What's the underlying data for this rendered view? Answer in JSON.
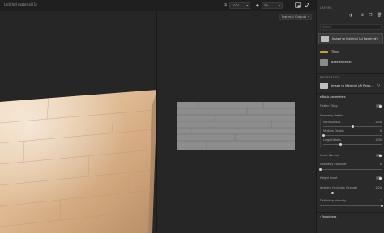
{
  "window": {
    "title": "Untitled material (1)"
  },
  "toolbar": {
    "resolution": "1024",
    "channels": "3D",
    "screenshot_icon": "camera-icon",
    "expand_icon": "expand-icon"
  },
  "viewport": {
    "mode_label": "Material Outputs"
  },
  "layers": {
    "heading": "LAYERS",
    "search_placeholder": "Search",
    "items": [
      {
        "label": "Image to Material (AI Powered)",
        "selected": true,
        "thumb_color": "#bdbdbd"
      },
      {
        "label": "Tiling",
        "selected": false,
        "thumb_color": "#c9a227"
      },
      {
        "label": "Base Material",
        "selected": false,
        "thumb_color": "#8a8a8a"
      }
    ]
  },
  "properties": {
    "heading": "PROPERTIES",
    "selected_label": "Image to Material (AI Powe…",
    "section": "Basic parameters",
    "rows": [
      {
        "label": "Flatten Tiling"
      },
      {
        "label": "Geometry Details"
      },
      {
        "label": "Micro Details",
        "value": "0.50"
      },
      {
        "label": "Medium Details",
        "value": "0"
      },
      {
        "label": "Large Details",
        "value": "0.30"
      },
      {
        "label": "Invert Normal"
      },
      {
        "label": "Geometry Equalizer",
        "value": "0"
      },
      {
        "label": "Height Invert"
      },
      {
        "label": "Ambient Occlusion Strength",
        "value": "0.20"
      },
      {
        "label": "Delighting Intensity",
        "value": "1"
      }
    ],
    "levels": {
      "micro": 0.5,
      "medium": 0,
      "large": 0.3,
      "equalizer": 0,
      "ao": 0.2,
      "delight": 1
    },
    "roughness_section": "Roughness"
  }
}
